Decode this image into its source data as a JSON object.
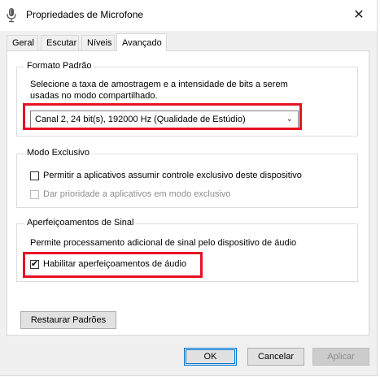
{
  "window": {
    "title": "Propriedades de Microfone",
    "icon": "microphone-icon",
    "close_glyph": "✕"
  },
  "tabs": [
    {
      "label": "Geral"
    },
    {
      "label": "Escutar"
    },
    {
      "label": "Níveis"
    },
    {
      "label": "Avançado",
      "active": true
    }
  ],
  "default_format": {
    "title": "Formato Padrão",
    "description_line1": "Selecione a taxa de amostragem e a intensidade de bits a serem",
    "description_line2": "usadas no modo compartilhado.",
    "selected_value": "Canal 2, 24 bit(s), 192000 Hz (Qualidade de Estúdio)"
  },
  "exclusive_mode": {
    "title": "Modo Exclusivo",
    "allow_exclusive_label": "Permitir a aplicativos assumir controle exclusivo deste dispositivo",
    "allow_exclusive_checked": false,
    "priority_label": "Dar prioridade a aplicativos em modo exclusivo",
    "priority_checked": false,
    "priority_enabled": false
  },
  "signal_enhancements": {
    "title": "Aperfeiçoamentos de Sinal",
    "description": "Permite processamento adicional de sinal pelo dispositivo de áudio",
    "enable_label": "Habilitar aperfeiçoamentos de áudio",
    "enable_checked": true
  },
  "restore_defaults_label": "Restaurar Padrões",
  "buttons": {
    "ok": "OK",
    "cancel": "Cancelar",
    "apply": "Aplicar"
  },
  "colors": {
    "highlight": "#e81123",
    "default_button_border": "#0078d7"
  }
}
